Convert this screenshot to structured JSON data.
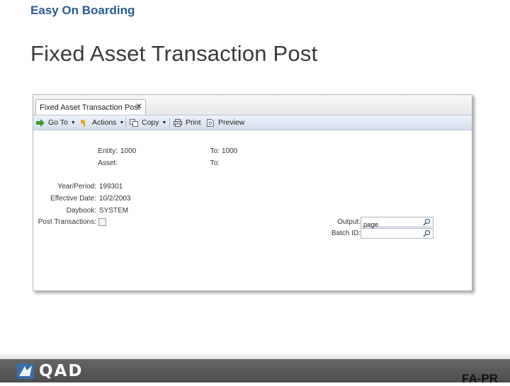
{
  "slide": {
    "subtitle": "Easy On Boarding",
    "title": "Fixed Asset Transaction Post",
    "footer_code": "FA-PR",
    "logo_text": "QAD"
  },
  "window": {
    "tab_label": "Fixed Asset Transaction Post",
    "close_glyph": "✕"
  },
  "toolbar": {
    "goto_label": "Go To",
    "actions_label": "Actions",
    "copy_label": "Copy",
    "print_label": "Print",
    "preview_label": "Preview",
    "dropdown_glyph": "▼",
    "icons": [
      "goto-arrow-icon",
      "actions-key-icon",
      "copy-icon",
      "print-icon",
      "preview-icon"
    ]
  },
  "form": {
    "entity_label": "Entity:",
    "entity_value": "1000",
    "to_entity_label": "To:",
    "to_entity_value": "1000",
    "asset_label": "Asset:",
    "asset_value": "",
    "to_asset_label": "To:",
    "to_asset_value": "",
    "period_label": "Year/Period:",
    "period_value": "199301",
    "effective_date_label": "Effective Date:",
    "effective_date_value": "10/2/2003",
    "daybook_label": "Daybook:",
    "daybook_value": "SYSTEM",
    "post_label": "Post Transactions:",
    "post_checked": false,
    "output_label": "Output:",
    "output_value": "page",
    "batch_label": "Batch ID:",
    "batch_value": ""
  },
  "colors": {
    "subtitle": "#2a5b93",
    "toolbar": "#d3deed",
    "footer": "#555555"
  }
}
